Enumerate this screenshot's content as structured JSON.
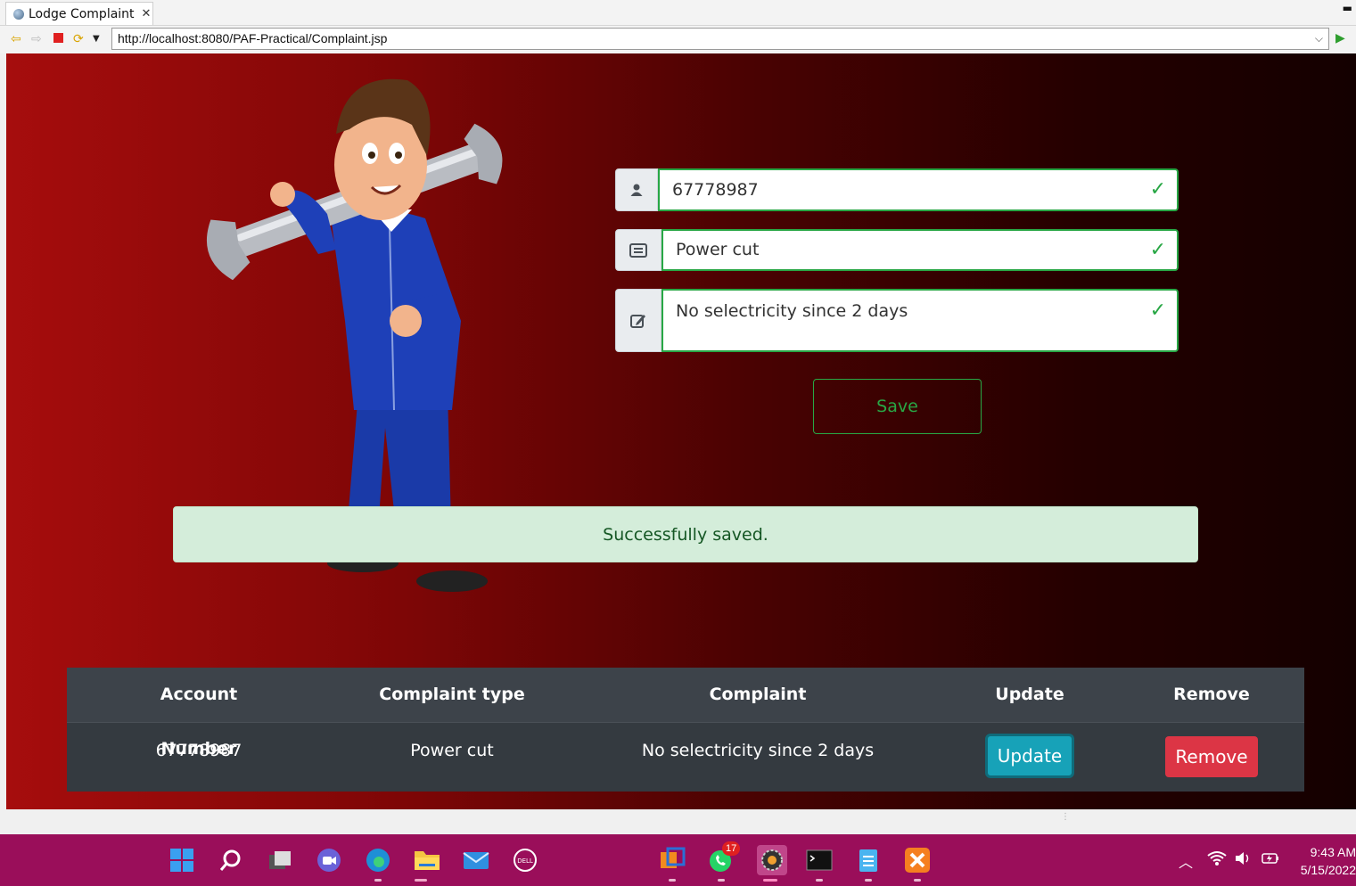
{
  "browser": {
    "tab_title": "Lodge Complaint",
    "url": "http://localhost:8080/PAF-Practical/Complaint.jsp"
  },
  "form": {
    "account_number": "67778987",
    "complaint_type": "Power cut",
    "complaint": "No selectricity since 2 days",
    "save_label": "Save"
  },
  "alert": {
    "message": "Successfully saved."
  },
  "table": {
    "headers": [
      "Account Number",
      "Complaint type",
      "Complaint",
      "Update",
      "Remove"
    ],
    "rows": [
      {
        "account": "67778987",
        "type": "Power cut",
        "complaint": "No selectricity since 2 days",
        "update": "Update",
        "remove": "Remove"
      }
    ]
  },
  "taskbar": {
    "whatsapp_badge": "17",
    "time": "9:43 AM",
    "date": "5/15/2022"
  },
  "colors": {
    "success": "#28a745",
    "alert_bg": "#d4edda",
    "update_btn": "#17a2b8",
    "remove_btn": "#dc3545",
    "taskbar": "#9a0e5a"
  }
}
